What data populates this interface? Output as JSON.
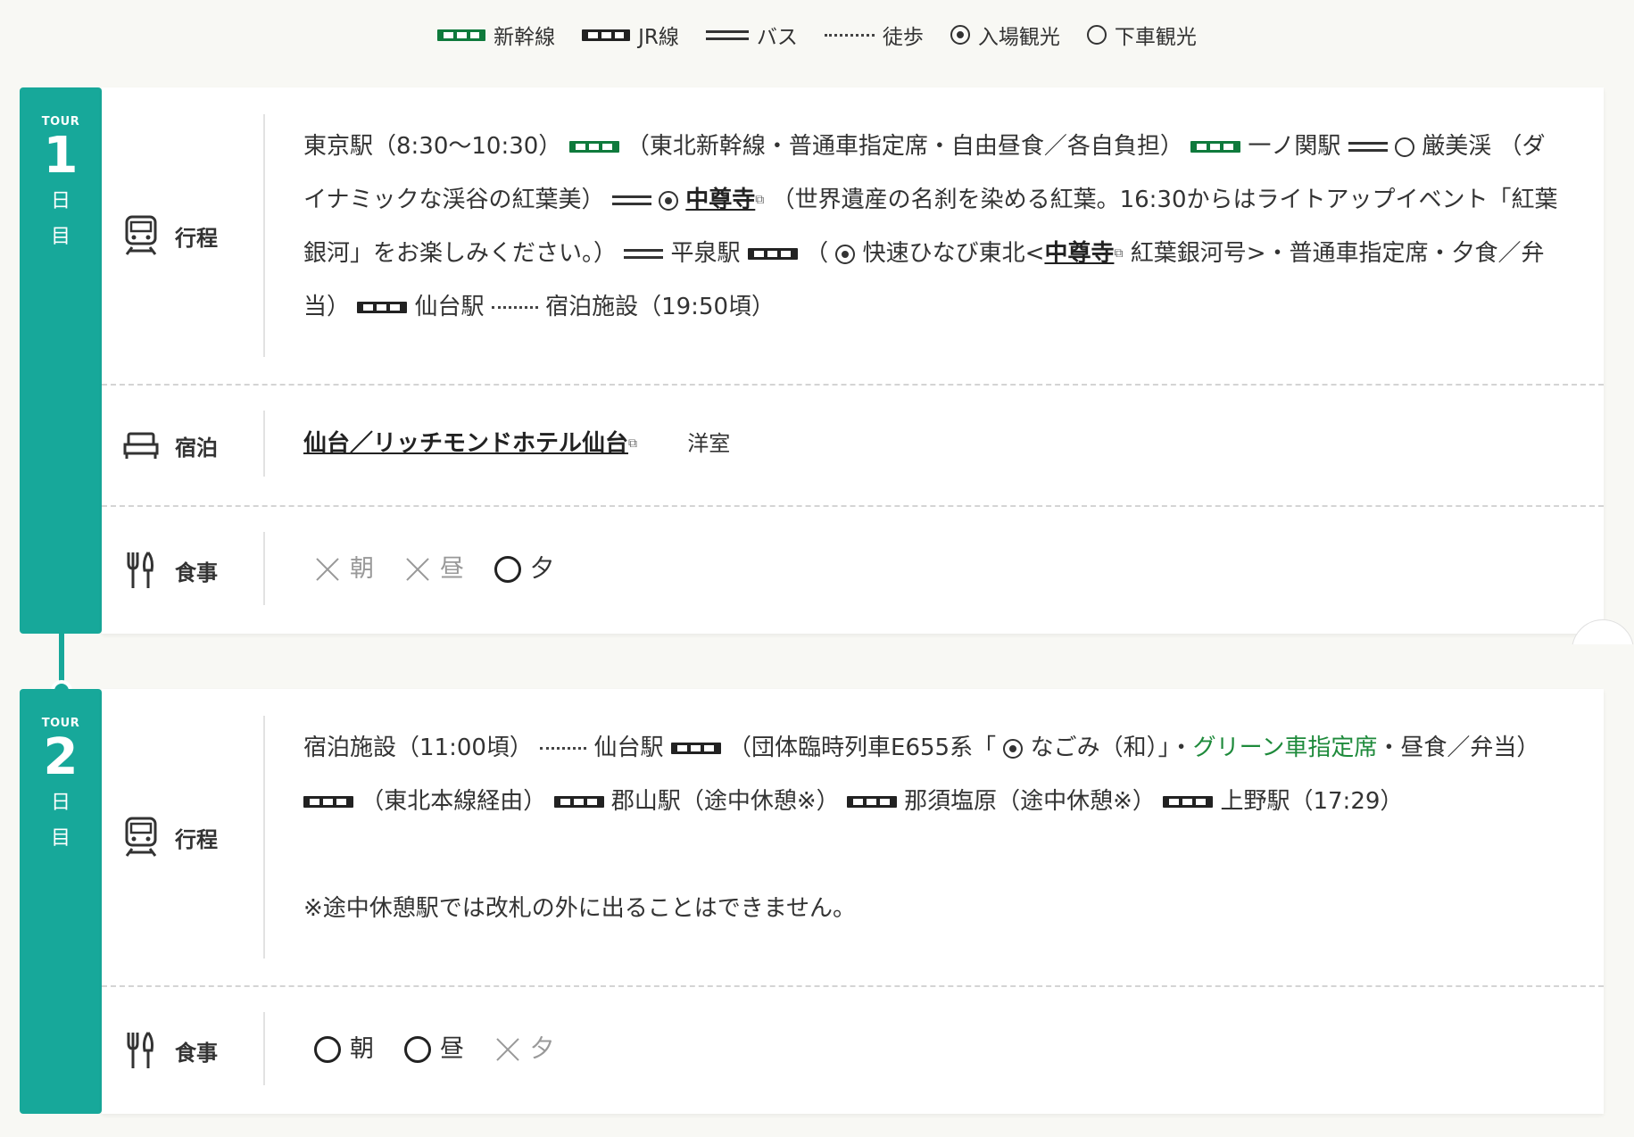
{
  "legend": [
    {
      "icon": "shinkansen-line-icon",
      "label": "新幹線"
    },
    {
      "icon": "jr-line-icon",
      "label": "JR線"
    },
    {
      "icon": "bus-line-icon",
      "label": "バス"
    },
    {
      "icon": "walk-line-icon",
      "label": "徒歩"
    },
    {
      "icon": "double-circle-icon",
      "label": "入場観光"
    },
    {
      "icon": "circle-icon",
      "label": "下車観光"
    }
  ],
  "colors": {
    "accent": "#17a89a",
    "shinkansen": "#0f7a3c",
    "jr": "#222222",
    "green_text": "#1e8a3b"
  },
  "days": [
    {
      "tour": "TOUR",
      "num": "1",
      "char1": "日",
      "char2": "目",
      "itinerary_label": "行程",
      "itinerary": {
        "t1": "東京駅（8:30〜10:30）",
        "t2": "（東北新幹線・普通車指定席・自由昼食／各自負担）",
        "t3": "一ノ関駅",
        "t4": "厳美渓",
        "t5": "（ダイナミックな渓谷の紅葉美）",
        "link1": "中尊寺",
        "t6": "（世界遺産の名刹を染める紅葉。16:30からはライトアップイベント「紅葉銀河」をお楽しみください。）",
        "t7": "平泉駅",
        "t8": "（",
        "t9": "快速ひなび東北<",
        "link2": "中尊寺",
        "t10": "紅葉銀河号>・普通車指定席・夕食／弁当）",
        "t11": "仙台駅",
        "t12": "宿泊施設（19:50頃）"
      },
      "stay_label": "宿泊",
      "stay": {
        "hotel": "仙台／リッチモンドホテル仙台",
        "room": "洋室"
      },
      "meal_label": "食事",
      "meals": [
        {
          "label": "朝",
          "mark": "×"
        },
        {
          "label": "昼",
          "mark": "×"
        },
        {
          "label": "夕",
          "mark": "○"
        }
      ]
    },
    {
      "tour": "TOUR",
      "num": "2",
      "char1": "日",
      "char2": "目",
      "itinerary_label": "行程",
      "itinerary": {
        "t1": "宿泊施設（11:00頃）",
        "t2": "仙台駅",
        "t3": "（団体臨時列車E655系「",
        "t4": "なごみ（和）」・",
        "green": "グリーン車指定席",
        "t5": "・昼食／弁当）",
        "t6": "（東北本線経由）",
        "t7": "郡山駅（途中休憩※）",
        "t8": "那須塩原（途中休憩※）",
        "t9": "上野駅（17:29）",
        "note": "※途中休憩駅では改札の外に出ることはできません。"
      },
      "meal_label": "食事",
      "meals": [
        {
          "label": "朝",
          "mark": "○"
        },
        {
          "label": "昼",
          "mark": "○"
        },
        {
          "label": "夕",
          "mark": "×"
        }
      ]
    }
  ]
}
